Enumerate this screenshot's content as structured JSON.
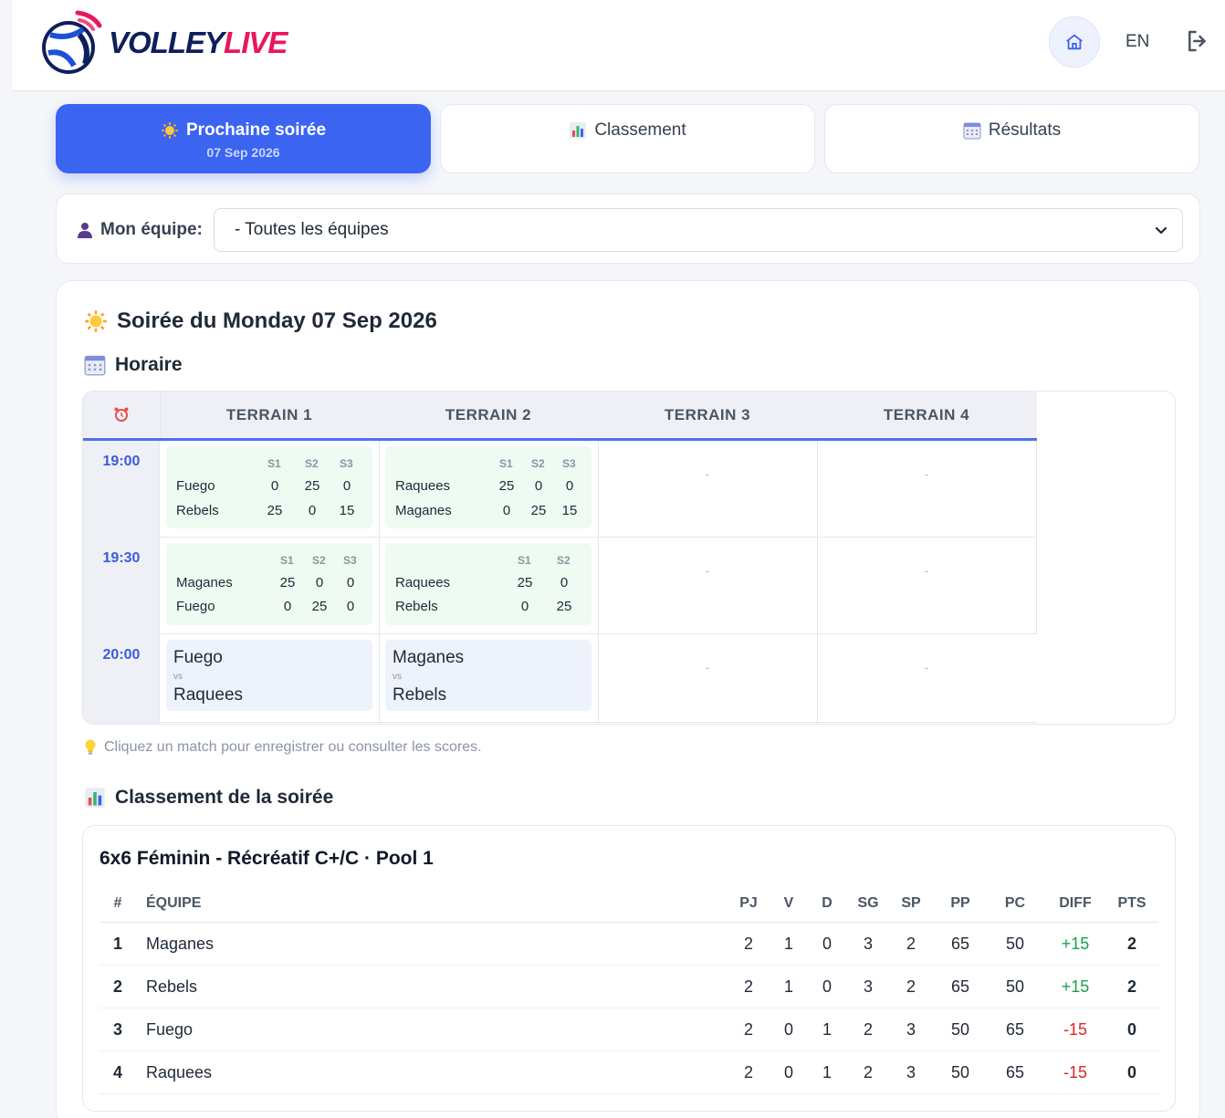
{
  "header": {
    "logo_text_a": "VOLLEY",
    "logo_text_b": "LIVE",
    "lang": "EN"
  },
  "tabs": [
    {
      "label": "Prochaine soirée",
      "sub": "07 Sep 2026",
      "icon": "sun-icon"
    },
    {
      "label": "Classement",
      "icon": "bar-chart-icon"
    },
    {
      "label": "Résultats",
      "icon": "calendar-icon"
    }
  ],
  "filter": {
    "label": "Mon équipe:",
    "selected": "- Toutes les équipes"
  },
  "soiree": {
    "title": "Soirée du Monday 07 Sep 2026",
    "horaire": "Horaire",
    "hint": "Cliquez un match pour enregistrer ou consulter les scores.",
    "classement_title": "Classement de la soirée"
  },
  "schedule": {
    "terrains": [
      "TERRAIN 1",
      "TERRAIN 2",
      "TERRAIN 3",
      "TERRAIN 4"
    ],
    "times": [
      "19:00",
      "19:30",
      "20:00"
    ],
    "empty": "-",
    "vs": "vs",
    "slot_1900": {
      "t1": {
        "sets": [
          "S1",
          "S2",
          "S3"
        ],
        "teamA": "Fuego",
        "scoresA": [
          "0",
          "25",
          "0"
        ],
        "teamB": "Rebels",
        "scoresB": [
          "25",
          "0",
          "15"
        ]
      },
      "t2": {
        "sets": [
          "S1",
          "S2",
          "S3"
        ],
        "teamA": "Raquees",
        "scoresA": [
          "25",
          "0",
          "0"
        ],
        "teamB": "Maganes",
        "scoresB": [
          "0",
          "25",
          "15"
        ]
      }
    },
    "slot_1930": {
      "t1": {
        "sets": [
          "S1",
          "S2",
          "S3"
        ],
        "teamA": "Maganes",
        "scoresA": [
          "25",
          "0",
          "0"
        ],
        "teamB": "Fuego",
        "scoresB": [
          "0",
          "25",
          "0"
        ]
      },
      "t2": {
        "sets": [
          "S1",
          "S2"
        ],
        "teamA": "Raquees",
        "scoresA": [
          "25",
          "0"
        ],
        "teamB": "Rebels",
        "scoresB": [
          "0",
          "25"
        ]
      }
    },
    "slot_2000": {
      "t1": {
        "teamA": "Fuego",
        "teamB": "Raquees"
      },
      "t2": {
        "teamA": "Maganes",
        "teamB": "Rebels"
      }
    }
  },
  "standings": {
    "title": "6x6 Féminin - Récréatif C+/C · Pool 1",
    "columns": [
      "#",
      "ÉQUIPE",
      "PJ",
      "V",
      "D",
      "SG",
      "SP",
      "PP",
      "PC",
      "DIFF",
      "PTS"
    ],
    "rows": [
      [
        "1",
        "Maganes",
        "2",
        "1",
        "0",
        "3",
        "2",
        "65",
        "50",
        "+15",
        "2"
      ],
      [
        "2",
        "Rebels",
        "2",
        "1",
        "0",
        "3",
        "2",
        "65",
        "50",
        "+15",
        "2"
      ],
      [
        "3",
        "Fuego",
        "2",
        "0",
        "1",
        "2",
        "3",
        "50",
        "65",
        "-15",
        "0"
      ],
      [
        "4",
        "Raquees",
        "2",
        "0",
        "1",
        "2",
        "3",
        "50",
        "65",
        "-15",
        "0"
      ]
    ]
  },
  "colors": {
    "accent": "#3b64f0",
    "brand_dark": "#0f1f5c",
    "brand_pink": "#e8175d",
    "positive": "#16a34a",
    "negative": "#dc2626"
  }
}
